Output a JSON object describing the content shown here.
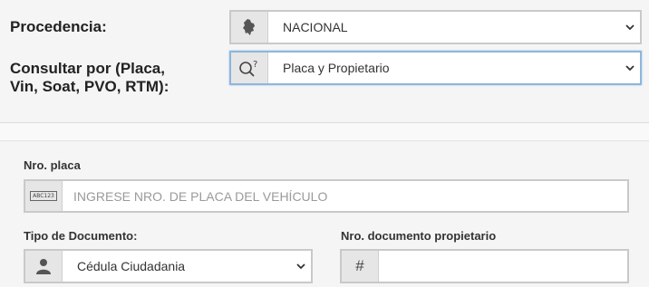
{
  "header": {
    "procedencia_label": "Procedencia:",
    "procedencia_value": "NACIONAL",
    "consultar_label_line1": "Consultar por (Placa,",
    "consultar_label_line2": "Vin, Soat, PVO, RTM):",
    "consultar_value": "Placa y Propietario"
  },
  "form": {
    "placa_label": "Nro. placa",
    "placa_icon_text": "ABC123",
    "placa_placeholder": "INGRESE NRO. DE PLACA DEL VEHÍCULO",
    "tipo_doc_label": "Tipo de Documento:",
    "tipo_doc_value": "Cédula Ciudadania",
    "nro_doc_label": "Nro. documento propietario",
    "nro_doc_icon": "#",
    "nro_doc_value": ""
  },
  "icons": {
    "procedencia": "colombia-map-icon",
    "consultar": "search-question-icon",
    "placa": "license-plate-icon",
    "tipo_doc": "person-icon",
    "nro_doc": "hash-icon",
    "dropdown": "chevron-down-icon"
  },
  "colors": {
    "active_border": "#8fb5db",
    "addon_bg": "#e6e6e6"
  }
}
